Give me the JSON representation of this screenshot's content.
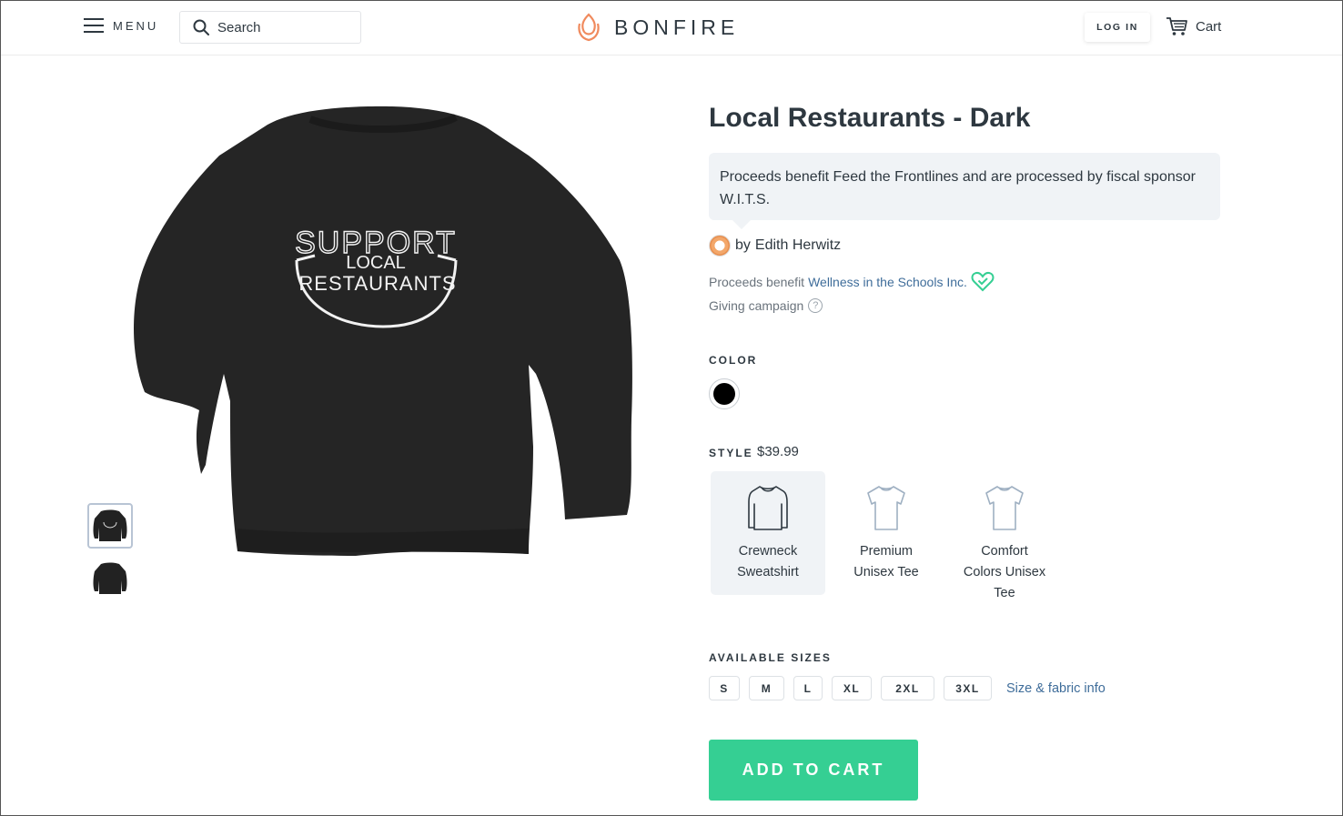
{
  "header": {
    "menu_label": "MENU",
    "search_placeholder": "Search",
    "logo_text": "BONFIRE",
    "login_label": "LOG IN",
    "cart_label": "Cart"
  },
  "product": {
    "title": "Local Restaurants - Dark",
    "description": "Proceeds benefit Feed the Frontlines and are processed by fiscal sponsor W.I.T.S.",
    "by_prefix": "by",
    "creator": "Edith Herwitz",
    "benefit_prefix": "Proceeds benefit",
    "benefit_org": "Wellness in the Schools Inc.",
    "giving_label": "Giving campaign",
    "image_text": [
      "SUPPORT",
      "LOCAL",
      "RESTAURANTS"
    ]
  },
  "color": {
    "label": "COLOR",
    "selected_hex": "#000000"
  },
  "style": {
    "label": "STYLE",
    "price": "$39.99",
    "options": [
      {
        "name_lines": [
          "Crewneck",
          "Sweatshirt"
        ],
        "icon": "sweatshirt-icon",
        "selected": true
      },
      {
        "name_lines": [
          "Premium",
          "Unisex Tee"
        ],
        "icon": "tshirt-icon",
        "selected": false
      },
      {
        "name_lines": [
          "Comfort",
          "Colors Unisex",
          "Tee"
        ],
        "icon": "tshirt-icon",
        "selected": false
      }
    ]
  },
  "sizes": {
    "label": "AVAILABLE SIZES",
    "options": [
      "S",
      "M",
      "L",
      "XL",
      "2XL",
      "3XL"
    ],
    "info_link": "Size & fabric info"
  },
  "cta": {
    "add_to_cart": "ADD TO CART",
    "color": "#35cf93"
  },
  "colors": {
    "text": "#2e3840",
    "link": "#3f6d9a",
    "logo_accent": "#f08a5d",
    "heart": "#35cf93"
  }
}
